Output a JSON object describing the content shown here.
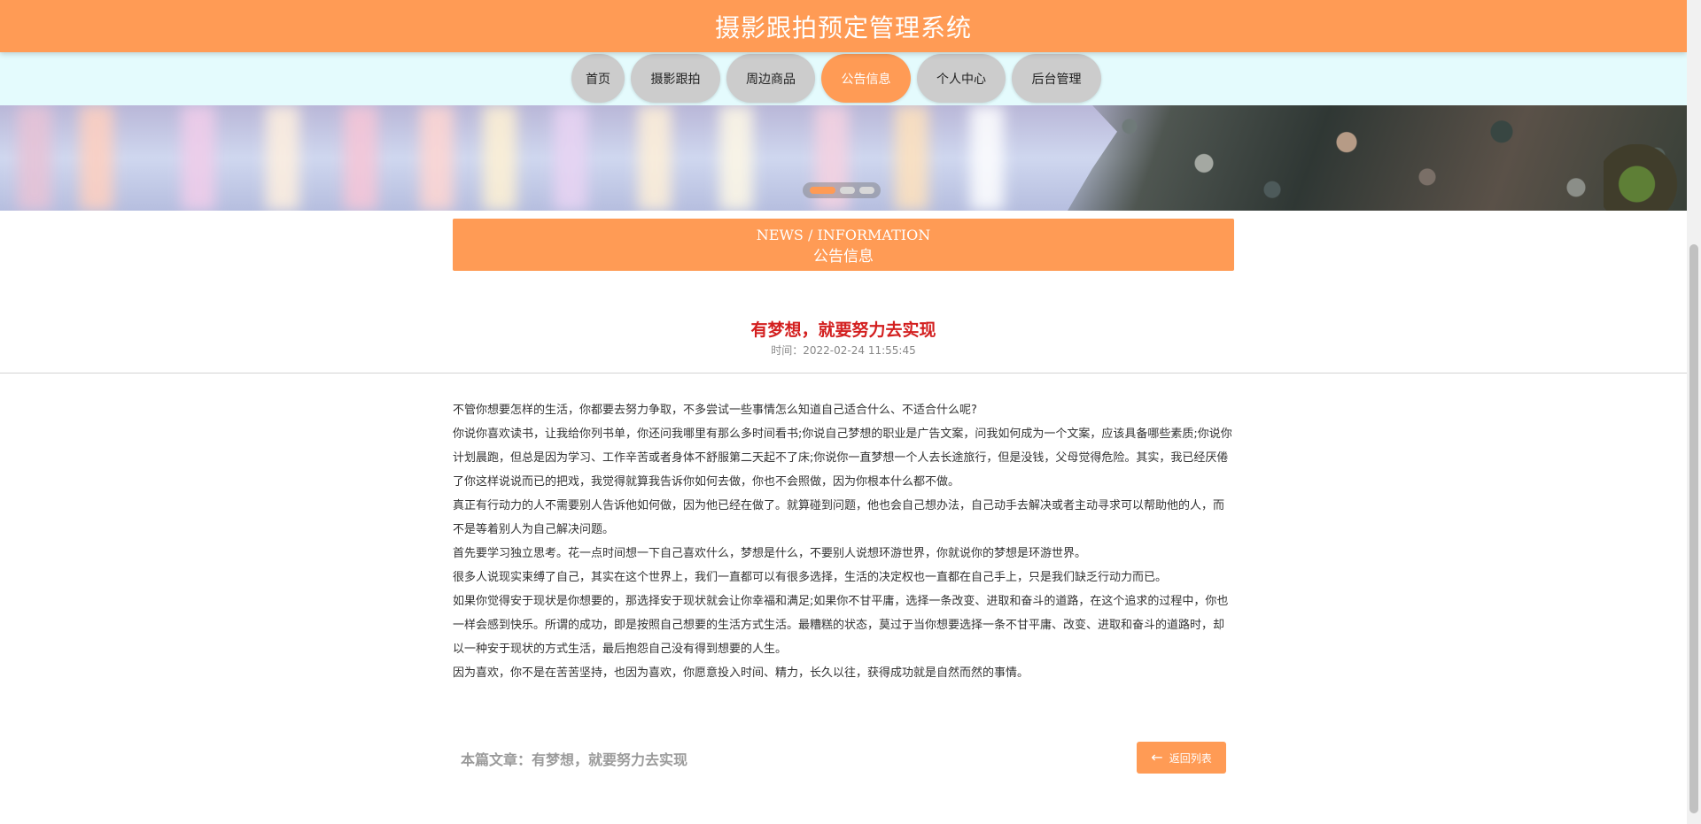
{
  "header": {
    "title": "摄影跟拍预定管理系统"
  },
  "nav": {
    "items": [
      {
        "label": "首页",
        "active": false
      },
      {
        "label": "摄影跟拍",
        "active": false
      },
      {
        "label": "周边商品",
        "active": false
      },
      {
        "label": "公告信息",
        "active": true
      },
      {
        "label": "个人中心",
        "active": false
      },
      {
        "label": "后台管理",
        "active": false
      }
    ]
  },
  "banner": {
    "active_slide": 1,
    "slide_count": 3
  },
  "section": {
    "english_title": "NEWS / INFORMATION",
    "chinese_title": "公告信息"
  },
  "article": {
    "title": "有梦想，就要努力去实现",
    "time": "时间：2022-02-24 11:55:45",
    "paragraphs": [
      "不管你想要怎样的生活，你都要去努力争取，不多尝试一些事情怎么知道自己适合什么、不适合什么呢?",
      "你说你喜欢读书，让我给你列书单，你还问我哪里有那么多时间看书;你说自己梦想的职业是广告文案，问我如何成为一个文案，应该具备哪些素质;你说你计划晨跑，但总是因为学习、工作辛苦或者身体不舒服第二天起不了床;你说你一直梦想一个人去长途旅行，但是没钱，父母觉得危险。其实，我已经厌倦了你这样说说而已的把戏，我觉得就算我告诉你如何去做，你也不会照做，因为你根本什么都不做。",
      "真正有行动力的人不需要别人告诉他如何做，因为他已经在做了。就算碰到问题，他也会自己想办法，自己动手去解决或者主动寻求可以帮助他的人，而不是等着别人为自己解决问题。",
      "首先要学习独立思考。花一点时间想一下自己喜欢什么，梦想是什么，不要别人说想环游世界，你就说你的梦想是环游世界。",
      "很多人说现实束缚了自己，其实在这个世界上，我们一直都可以有很多选择，生活的决定权也一直都在自己手上，只是我们缺乏行动力而已。",
      "如果你觉得安于现状是你想要的，那选择安于现状就会让你幸福和满足;如果你不甘平庸，选择一条改变、进取和奋斗的道路，在这个追求的过程中，你也一样会感到快乐。所谓的成功，即是按照自己想要的生活方式生活。最糟糕的状态，莫过于当你想要选择一条不甘平庸、改变、进取和奋斗的道路时，却以一种安于现状的方式生活，最后抱怨自己没有得到想要的人生。",
      "因为喜欢，你不是在苦苦坚持，也因为喜欢，你愿意投入时间、精力，长久以往，获得成功就是自然而然的事情。"
    ]
  },
  "footer": {
    "article_label": "本篇文章：有梦想，就要努力去实现",
    "back_label": "返回列表",
    "back_icon": "arrow-left-icon"
  },
  "colors": {
    "accent": "#ff9b55",
    "nav_background": "#e4fbfd",
    "article_title": "#d31f1f",
    "inactive_nav": "#cccccc"
  }
}
